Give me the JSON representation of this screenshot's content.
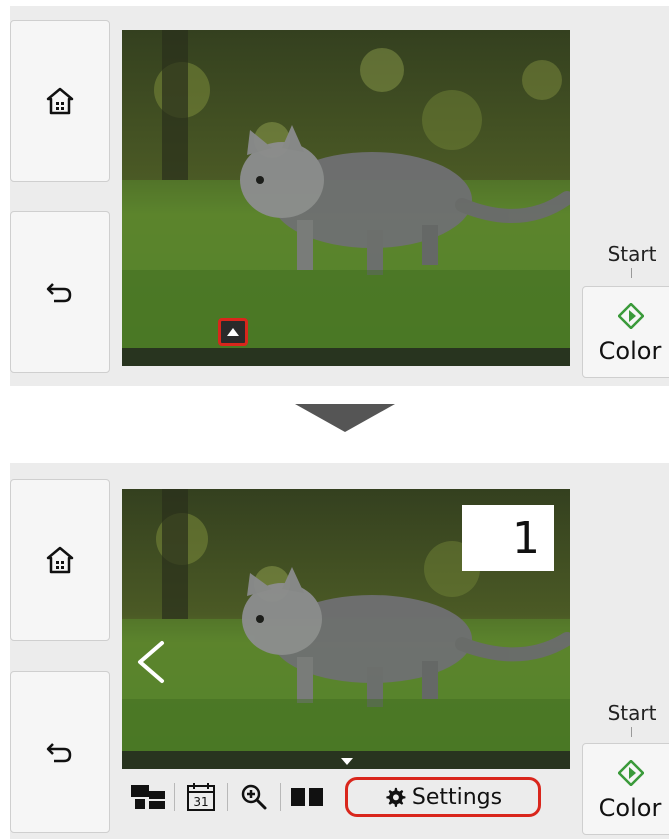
{
  "top_screen": {
    "start_label": "Start",
    "color_label": "Color",
    "expand_icon": "caret-up-icon"
  },
  "bottom_screen": {
    "start_label": "Start",
    "color_label": "Color",
    "badge_count": "1",
    "copies_value": "1",
    "toolbar": {
      "layout_icon": "layout-icon",
      "date_icon_text": "31",
      "zoom_icon": "zoom-in-icon",
      "display_icon": "two-page-icon",
      "settings_label": "Settings"
    }
  },
  "colors": {
    "panel": "#ececec",
    "button_border": "#cfcfcf",
    "highlight": "#d9261c",
    "start_green": "#3a9a3a"
  }
}
